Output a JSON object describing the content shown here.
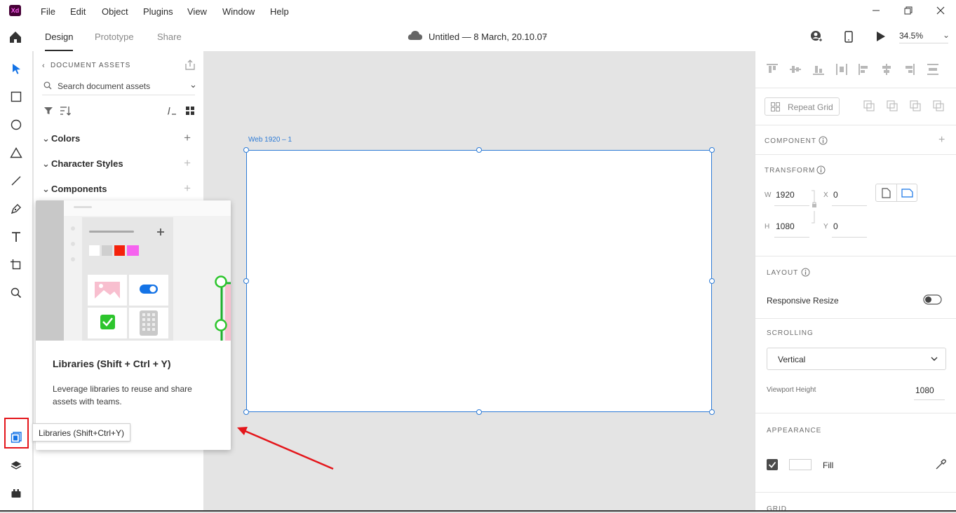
{
  "menubar": {
    "logo": "Xd",
    "items": [
      "File",
      "Edit",
      "Object",
      "Plugins",
      "View",
      "Window",
      "Help"
    ]
  },
  "toolbar": {
    "tabs": [
      "Design",
      "Prototype",
      "Share"
    ],
    "doc_title": "Untitled — 8 March, 20.10.07",
    "zoom": "34.5%"
  },
  "assets": {
    "header": "DOCUMENT ASSETS",
    "search_placeholder": "Search document assets",
    "sections": [
      "Colors",
      "Character Styles",
      "Components"
    ]
  },
  "canvas": {
    "artboard_label": "Web 1920 – 1"
  },
  "popup": {
    "title": "Libraries (Shift + Ctrl + Y)",
    "description": "Leverage libraries to reuse and share assets with teams."
  },
  "tooltip": "Libraries (Shift+Ctrl+Y)",
  "props": {
    "repeat_grid": "Repeat Grid",
    "component": "COMPONENT",
    "transform": "TRANSFORM",
    "w_label": "W",
    "w": "1920",
    "x_label": "X",
    "x": "0",
    "h_label": "H",
    "h": "1080",
    "y_label": "Y",
    "y": "0",
    "layout": "LAYOUT",
    "responsive_resize": "Responsive Resize",
    "scrolling": "SCROLLING",
    "scroll_value": "Vertical",
    "viewport_height_label": "Viewport Height",
    "viewport_height": "1080",
    "appearance": "APPEARANCE",
    "fill": "Fill",
    "grid": "GRID"
  },
  "colors": {
    "accent": "#2d7bd6",
    "highlight": "#e4161b",
    "xd_brand": "#470137"
  }
}
